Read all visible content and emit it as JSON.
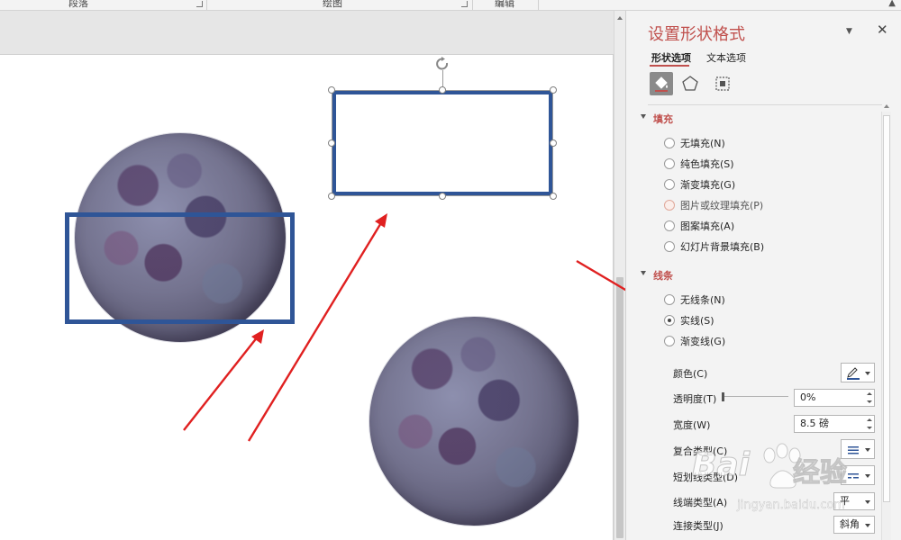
{
  "ribbon": {
    "groups": [
      "段落",
      "绘图",
      "编辑"
    ]
  },
  "pane": {
    "title": "设置形状格式",
    "tabs": [
      {
        "label": "形状选项",
        "active": true
      },
      {
        "label": "文本选项",
        "active": false
      }
    ],
    "icon_tabs": [
      "fill-line-icon",
      "pentagon-icon",
      "size-properties-icon"
    ],
    "fill": {
      "heading": "填充",
      "options": [
        {
          "label": "无填充(N)",
          "checked": false
        },
        {
          "label": "纯色填充(S)",
          "checked": false
        },
        {
          "label": "渐变填充(G)",
          "checked": false
        },
        {
          "label": "图片或纹理填充(P)",
          "checked": false
        },
        {
          "label": "图案填充(A)",
          "checked": false
        },
        {
          "label": "幻灯片背景填充(B)",
          "checked": false
        }
      ]
    },
    "line": {
      "heading": "线条",
      "options": [
        {
          "label": "无线条(N)",
          "checked": false
        },
        {
          "label": "实线(S)",
          "checked": true
        },
        {
          "label": "渐变线(G)",
          "checked": false
        }
      ],
      "color_label": "颜色(C)",
      "transparency_label": "透明度(T)",
      "transparency_value": "0%",
      "width_label": "宽度(W)",
      "width_value": "8.5 磅",
      "compound_label": "复合类型(C)",
      "dash_label": "短划线类型(D)",
      "cap_label": "线端类型(A)",
      "cap_value": "平",
      "join_label": "连接类型(J)",
      "join_value": "斜角"
    }
  },
  "watermark": {
    "brand": "Bai",
    "brand2": "经验",
    "url": "jingyan.baidu.com"
  },
  "colors": {
    "accent": "#c0504d",
    "shape_border": "#2f5597",
    "arrow": "#e02020"
  }
}
